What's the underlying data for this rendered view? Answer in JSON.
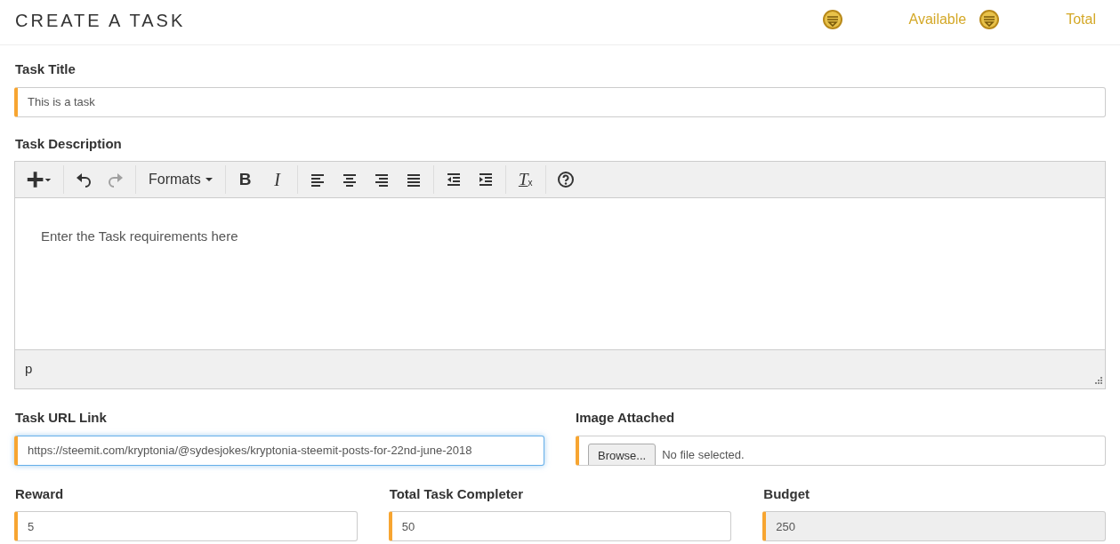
{
  "header": {
    "title": "CREATE A TASK",
    "available_label": "Available",
    "total_label": "Total"
  },
  "task_title": {
    "label": "Task Title",
    "value": "This is a task"
  },
  "task_description": {
    "label": "Task Description",
    "formats_label": "Formats",
    "placeholder": "Enter the Task requirements here",
    "path": "p",
    "toolbar": [
      {
        "kind": "insert",
        "disabled": false
      },
      {
        "kind": "undo",
        "disabled": false
      },
      {
        "kind": "redo",
        "disabled": true
      },
      {
        "kind": "formats",
        "disabled": false
      },
      {
        "kind": "bold",
        "label": "B",
        "disabled": false
      },
      {
        "kind": "italic",
        "label": "I",
        "disabled": false
      },
      {
        "kind": "align-left",
        "disabled": false
      },
      {
        "kind": "align-center",
        "disabled": false
      },
      {
        "kind": "align-right",
        "disabled": false
      },
      {
        "kind": "justify",
        "disabled": false
      },
      {
        "kind": "outdent",
        "disabled": false
      },
      {
        "kind": "indent",
        "disabled": false
      },
      {
        "kind": "clear",
        "label": "T",
        "sub": "x",
        "disabled": false
      },
      {
        "kind": "help",
        "disabled": false
      }
    ]
  },
  "task_url": {
    "label": "Task URL Link",
    "value": "https://steemit.com/kryptonia/@sydesjokes/kryptonia-steemit-posts-for-22nd-june-2018",
    "focused": true
  },
  "image": {
    "label": "Image Attached",
    "button": "Browse...",
    "status": "No file selected."
  },
  "fields": [
    {
      "label": "Reward",
      "value": "5",
      "disabled": false
    },
    {
      "label": "Total Task Completer",
      "value": "50",
      "disabled": false
    },
    {
      "label": "Budget",
      "value": "250",
      "disabled": true
    }
  ]
}
